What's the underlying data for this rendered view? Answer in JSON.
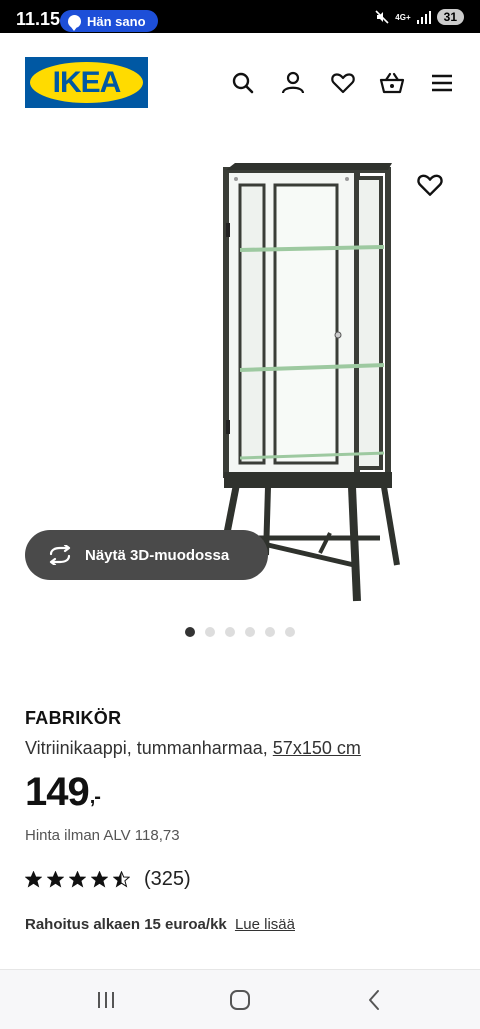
{
  "status_bar": {
    "time": "11.15",
    "notification": "Hän sano",
    "network": "4G+",
    "battery": "31"
  },
  "header": {
    "logo_text": "IKEA",
    "icons": [
      "search-icon",
      "account-icon",
      "heart-icon",
      "basket-icon",
      "menu-icon"
    ]
  },
  "gallery": {
    "view_3d_label": "Näytä 3D-muodossa",
    "dot_count": 6,
    "active_dot": 0
  },
  "product": {
    "name": "FABRIKÖR",
    "description": "Vitriinikaappi, tummanharmaa,",
    "size_link": "57x150 cm",
    "price": "149",
    "price_suffix": ",-",
    "price_excl_vat": "Hinta ilman ALV 118,73",
    "rating": 4.5,
    "review_count": "(325)",
    "finance_text": "Rahoitus alkaen 15 euroa/kk",
    "finance_link": "Lue lisää"
  },
  "colors": {
    "ikea_blue": "#0058a3",
    "ikea_yellow": "#ffdb00",
    "notification_blue": "#1d4fd8",
    "button_dark": "#4a4a4a"
  },
  "nav_bar": {
    "icons": [
      "recent-apps-icon",
      "home-icon",
      "back-icon"
    ]
  }
}
